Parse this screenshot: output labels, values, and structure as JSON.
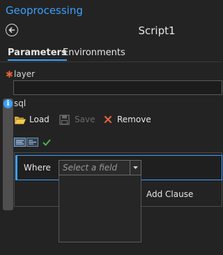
{
  "header": {
    "title": "Geoprocessing"
  },
  "tool": {
    "name": "Script1"
  },
  "tabs": [
    {
      "label": "Parameters",
      "active": true
    },
    {
      "label": "Environments",
      "active": false
    }
  ],
  "params": {
    "layer": {
      "label": "layer",
      "value": "",
      "required": true
    },
    "sql": {
      "label": "sql",
      "toolbar": {
        "load": "Load",
        "save": "Save",
        "remove": "Remove"
      },
      "clause": {
        "where_label": "Where",
        "field_placeholder": "Select a field",
        "add_clause": "Add Clause"
      }
    }
  },
  "colors": {
    "accent": "#3aa1ff",
    "background": "#232323",
    "required": "#e0623d",
    "remove": "#e0623d",
    "check": "#4caf50"
  }
}
